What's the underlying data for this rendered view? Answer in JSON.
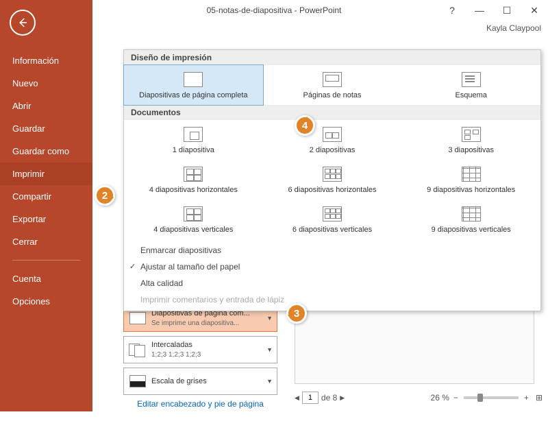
{
  "window": {
    "title": "05-notas-de-diapositiva - PowerPoint",
    "help": "?",
    "username": "Kayla Claypool"
  },
  "sidebar": {
    "items": [
      "Información",
      "Nuevo",
      "Abrir",
      "Guardar",
      "Guardar como",
      "Imprimir",
      "Compartir",
      "Exportar",
      "Cerrar"
    ],
    "bottom": [
      "Cuenta",
      "Opciones"
    ],
    "active_index": 5
  },
  "panel": {
    "section1": "Diseño de impresión",
    "row1": [
      "Diapositivas de página completa",
      "Páginas de notas",
      "Esquema"
    ],
    "section2": "Documentos",
    "row2": [
      "1 diapositiva",
      "2 diapositivas",
      "3 diapositivas"
    ],
    "row3": [
      "4 diapositivas horizontales",
      "6 diapositivas horizontales",
      "9 diapositivas horizontales"
    ],
    "row4": [
      "4 diapositivas verticales",
      "6 diapositivas verticales",
      "9 diapositivas verticales"
    ],
    "opts": [
      "Enmarcar diapositivas",
      "Ajustar al tamaño del papel",
      "Alta calidad",
      "Imprimir comentarios y entrada de lápiz"
    ]
  },
  "settings": {
    "layout": {
      "title": "Diapositivas de página com...",
      "sub": "Se imprime una diapositiva..."
    },
    "collate": {
      "title": "Intercaladas",
      "sub": "1;2;3   1;2;3   1;2;3"
    },
    "color": {
      "title": "Escala de grises"
    },
    "edit_link": "Editar encabezado y pie de página"
  },
  "status": {
    "page": "1",
    "page_of": "de 8",
    "zoom": "26 %"
  },
  "callouts": {
    "c2": "2",
    "c3": "3",
    "c4": "4"
  }
}
